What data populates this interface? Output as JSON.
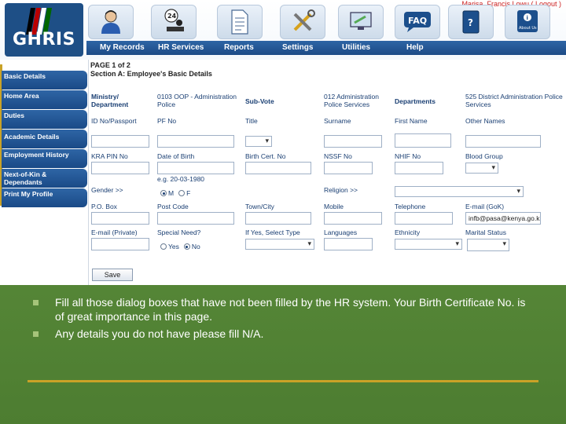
{
  "header": {
    "logo_text": "GHRIS",
    "user_line": "Marisa, Francis Lowu ( Logout )",
    "nav": [
      {
        "label": "My Records",
        "icon": "user-icon"
      },
      {
        "label": "HR Services",
        "icon": "service-24-icon"
      },
      {
        "label": "Reports",
        "icon": "document-icon"
      },
      {
        "label": "Settings",
        "icon": "tools-icon"
      },
      {
        "label": "Utilities",
        "icon": "utilities-icon"
      },
      {
        "label": "Help",
        "icon": "faq-icon"
      }
    ],
    "faq_label": "FAQ",
    "about_label": "About Us"
  },
  "sidebar": {
    "items": [
      {
        "label": "Basic Details"
      },
      {
        "label": "Home Area"
      },
      {
        "label": "Duties"
      },
      {
        "label": "Academic Details"
      },
      {
        "label": "Employment History"
      },
      {
        "label": "Next-of-Kin & Dependants"
      },
      {
        "label": "Print My Profile"
      }
    ]
  },
  "form": {
    "page_label": "PAGE 1 of 2",
    "section_title": "Section A: Employee's Basic Details",
    "ministry_label": "Ministry/ Department",
    "ministry_value": "0103 OOP - Administration Police",
    "subvote_label": "Sub-Vote",
    "subvote_value": "012 Administration Police Services",
    "departments_label": "Departments",
    "departments_value": "525 District Administration Police Services",
    "labels": {
      "id_no": "ID No/Passport",
      "pf_no": "PF No",
      "title": "Title",
      "surname": "Surname",
      "first_name": "First Name",
      "other_names": "Other Names",
      "kra_pin": "KRA PIN No",
      "dob": "Date of Birth",
      "birth_cert": "Birth Cert. No",
      "nssf": "NSSF No",
      "nhif": "NHIF No",
      "blood_group": "Blood Group",
      "gender": "Gender >>",
      "religion": "Religion >>",
      "po_box": "P.O. Box",
      "post_code": "Post Code",
      "town": "Town/City",
      "mobile": "Mobile",
      "telephone": "Telephone",
      "email_gok": "E-mail (GoK)",
      "email_private": "E-mail (Private)",
      "special_need": "Special Need?",
      "if_yes": "If Yes, Select Type",
      "languages": "Languages",
      "ethnicity": "Ethnicity",
      "marital": "Marital Status"
    },
    "dob_hint": "e.g. 20-03-1980",
    "gender_options": [
      "M",
      "F"
    ],
    "special_options": [
      "Yes",
      "No"
    ],
    "email_gok_value": "infb@pasa@kenya.go.k",
    "save_label": "Save"
  },
  "slide": {
    "bullets": [
      "Fill all those dialog boxes that have not been filled by the HR system. Your Birth Certificate No. is of great importance in this page.",
      "Any details you do not have please fill N/A."
    ]
  }
}
